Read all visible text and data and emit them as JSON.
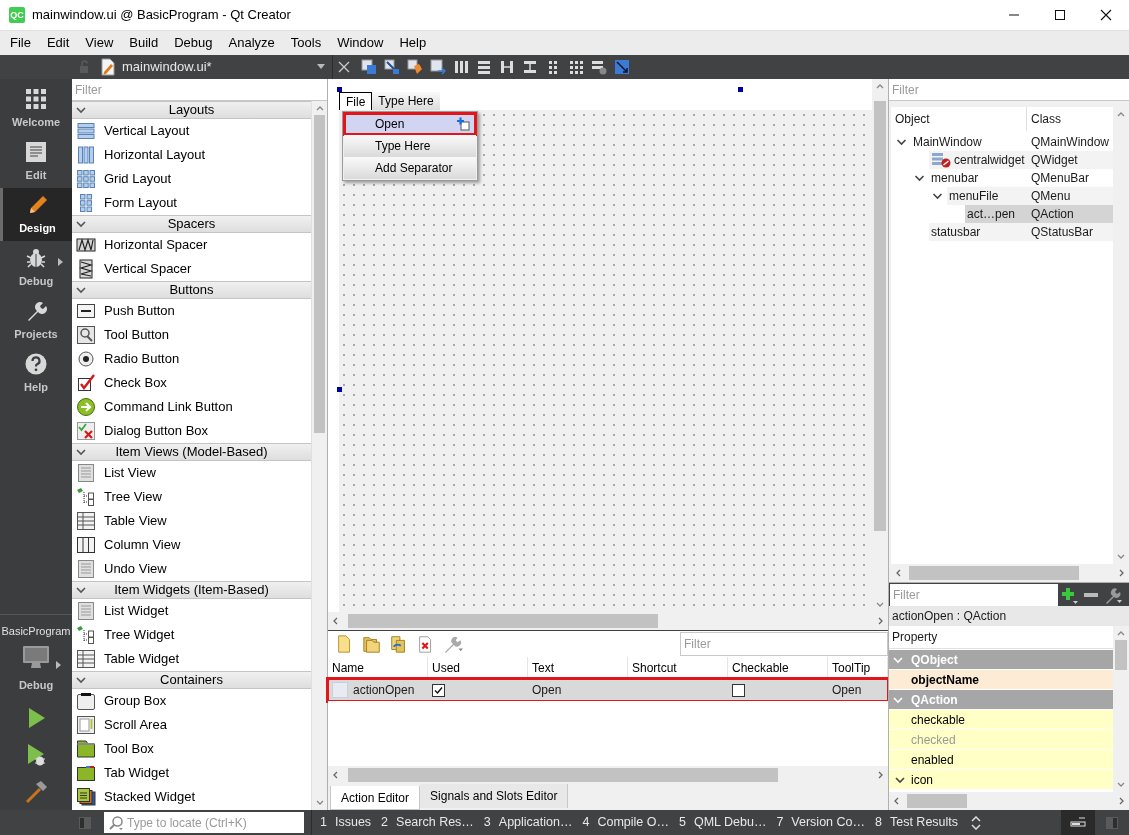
{
  "window": {
    "title": "mainwindow.ui @ BasicProgram - Qt Creator",
    "app_icon": "QC"
  },
  "menu_bar": [
    "File",
    "Edit",
    "View",
    "Build",
    "Debug",
    "Analyze",
    "Tools",
    "Window",
    "Help"
  ],
  "editor_toolbar": {
    "document": "mainwindow.ui*"
  },
  "mode_bar": {
    "modes": [
      {
        "kind": "welcome",
        "label": "Welcome",
        "selected": false
      },
      {
        "kind": "edit",
        "label": "Edit",
        "selected": false
      },
      {
        "kind": "design",
        "label": "Design",
        "selected": true
      },
      {
        "kind": "debug",
        "label": "Debug",
        "selected": false
      },
      {
        "kind": "projects",
        "label": "Projects",
        "selected": false
      },
      {
        "kind": "help",
        "label": "Help",
        "selected": false
      }
    ],
    "target": {
      "project": "BasicProgram",
      "build": "Debug"
    }
  },
  "widget_box": {
    "filter": {
      "placeholder": "Filter"
    },
    "categories": [
      {
        "label": "Layouts",
        "expanded": true,
        "items": [
          {
            "kind": "vlayout",
            "label": "Vertical Layout"
          },
          {
            "kind": "hlayout",
            "label": "Horizontal Layout"
          },
          {
            "kind": "grid",
            "label": "Grid Layout"
          },
          {
            "kind": "form",
            "label": "Form Layout"
          }
        ]
      },
      {
        "label": "Spacers",
        "expanded": true,
        "items": [
          {
            "kind": "hspacer",
            "label": "Horizontal Spacer"
          },
          {
            "kind": "vspacer",
            "label": "Vertical Spacer"
          }
        ]
      },
      {
        "label": "Buttons",
        "expanded": true,
        "items": [
          {
            "kind": "push",
            "label": "Push Button"
          },
          {
            "kind": "tool",
            "label": "Tool Button"
          },
          {
            "kind": "radio",
            "label": "Radio Button"
          },
          {
            "kind": "check",
            "label": "Check Box"
          },
          {
            "kind": "link",
            "label": "Command Link Button"
          },
          {
            "kind": "dialog",
            "label": "Dialog Button Box"
          }
        ]
      },
      {
        "label": "Item Views (Model-Based)",
        "expanded": true,
        "items": [
          {
            "kind": "list",
            "label": "List View"
          },
          {
            "kind": "tree",
            "label": "Tree View"
          },
          {
            "kind": "table",
            "label": "Table View"
          },
          {
            "kind": "column",
            "label": "Column View"
          },
          {
            "kind": "list",
            "label": "Undo View"
          }
        ]
      },
      {
        "label": "Item Widgets (Item-Based)",
        "expanded": true,
        "items": [
          {
            "kind": "list",
            "label": "List Widget"
          },
          {
            "kind": "tree",
            "label": "Tree Widget"
          },
          {
            "kind": "table",
            "label": "Table Widget"
          }
        ]
      },
      {
        "label": "Containers",
        "expanded": true,
        "items": [
          {
            "kind": "group",
            "label": "Group Box"
          },
          {
            "kind": "scroll",
            "label": "Scroll Area"
          },
          {
            "kind": "toolbox",
            "label": "Tool Box"
          },
          {
            "kind": "tab",
            "label": "Tab Widget"
          },
          {
            "kind": "stacked",
            "label": "Stacked Widget"
          }
        ]
      }
    ]
  },
  "form_editor": {
    "menu_bar": [
      {
        "label": "File",
        "selected": true
      },
      {
        "label": "Type Here",
        "selected": false
      }
    ],
    "menu": [
      {
        "label": "Open",
        "selected": true,
        "highlighted": true
      },
      {
        "label": "Type Here",
        "selected": false,
        "highlighted": false
      },
      {
        "label": "Add Separator",
        "selected": false,
        "highlighted": false
      }
    ]
  },
  "action_editor": {
    "filter": {
      "placeholder": "Filter"
    },
    "columns": [
      "Name",
      "Used",
      "Text",
      "Shortcut",
      "Checkable",
      "ToolTip"
    ],
    "rows": [
      {
        "name": "actionOpen",
        "used": true,
        "text": "Open",
        "checkable": false,
        "tooltip": "Open",
        "selected": true,
        "highlighted": true
      }
    ],
    "tabs": [
      {
        "label": "Action Editor",
        "selected": true
      },
      {
        "label": "Signals and Slots Editor",
        "selected": false
      }
    ]
  },
  "object_inspector": {
    "filter": {
      "placeholder": "Filter"
    },
    "columns": [
      "Object",
      "Class"
    ],
    "tree": [
      {
        "name": "MainWindow",
        "class": "QMainWindow",
        "expanded": true,
        "selected": false,
        "broken_layout": false,
        "children": [
          {
            "name": "centralwidget",
            "class": "QWidget",
            "selected": false,
            "broken_layout": true
          },
          {
            "name": "menubar",
            "class": "QMenuBar",
            "expanded": true,
            "selected": false,
            "broken_layout": false,
            "children": [
              {
                "name": "menuFile",
                "class": "QMenu",
                "expanded": true,
                "selected": false,
                "broken_layout": false,
                "children": [
                  {
                    "name": "act…pen",
                    "class": "QAction",
                    "selected": true,
                    "broken_layout": false
                  }
                ]
              }
            ]
          },
          {
            "name": "statusbar",
            "class": "QStatusBar",
            "selected": false,
            "broken_layout": false
          }
        ]
      }
    ]
  },
  "property_editor": {
    "filter": {
      "placeholder": "Filter"
    },
    "object": "actionOpen : QAction",
    "header": "Property",
    "groups": [
      {
        "label": "QObject",
        "expanded": true,
        "properties": [
          {
            "label": "objectName",
            "modified": true,
            "disabled": false
          }
        ]
      },
      {
        "label": "QAction",
        "expanded": true,
        "properties": [
          {
            "label": "checkable",
            "modified": false,
            "disabled": false
          },
          {
            "label": "checked",
            "modified": false,
            "disabled": true
          },
          {
            "label": "enabled",
            "modified": false,
            "disabled": false
          },
          {
            "label": "icon",
            "modified": false,
            "disabled": false,
            "expanded": true
          }
        ]
      }
    ]
  },
  "status_bar": {
    "locate": {
      "placeholder": "Type to locate (Ctrl+K)"
    },
    "panes": [
      {
        "number": "1",
        "label": "Issues"
      },
      {
        "number": "2",
        "label": "Search Res…"
      },
      {
        "number": "3",
        "label": "Application…"
      },
      {
        "number": "4",
        "label": "Compile O…"
      },
      {
        "number": "5",
        "label": "QML Debu…"
      },
      {
        "number": "7",
        "label": "Version Co…"
      },
      {
        "number": "8",
        "label": "Test Results"
      }
    ]
  }
}
